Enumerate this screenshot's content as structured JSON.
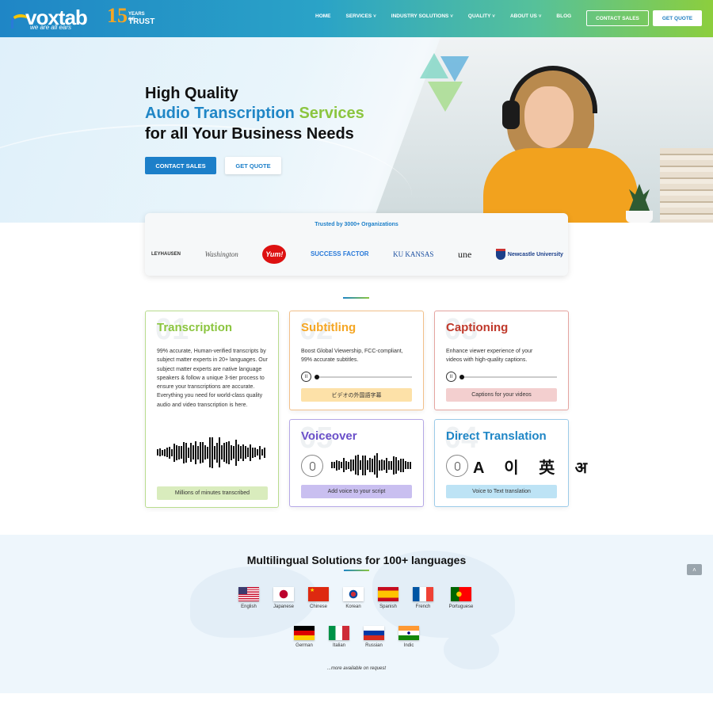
{
  "brand": {
    "name": "voxtab",
    "tagline": "we are all ears",
    "badge_number": "15",
    "badge_years": "YEARS OF",
    "badge_trust": "TRUST"
  },
  "nav": {
    "items": [
      {
        "label": "HOME",
        "dropdown": false
      },
      {
        "label": "SERVICES",
        "dropdown": true
      },
      {
        "label": "INDUSTRY SOLUTIONS",
        "dropdown": true
      },
      {
        "label": "QUALITY",
        "dropdown": true
      },
      {
        "label": "ABOUT US",
        "dropdown": true
      },
      {
        "label": "BLOG",
        "dropdown": false
      }
    ],
    "contact_sales": "CONTACT SALES",
    "get_quote": "GET QUOTE"
  },
  "hero": {
    "line1": "High Quality",
    "line2_a": "Audio Transcription",
    "line2_b": "Services",
    "line3": "for all Your Business Needs",
    "btn_contact": "CONTACT SALES",
    "btn_quote": "GET QUOTE"
  },
  "trusted": {
    "title": "Trusted by 3000+ Organizations",
    "orgs": [
      "LEYHAUSEN",
      "Washington",
      "Yum!",
      "SUCCESS FACTOR",
      "KU KANSAS",
      "une",
      "Newcastle University"
    ]
  },
  "cards": {
    "transcription": {
      "num": "01",
      "title": "Transcription",
      "text": "99% accurate, Human-verified transcripts by subject matter experts in 20+ languages. Our subject matter experts are native language speakers & follow a unique 3-tier process to ensure your transcriptions are accurate. Everything you need for world-class quality audio and video transcription is here.",
      "pill": "Millions of minutes transcribed"
    },
    "subtitling": {
      "num": "02",
      "title": "Subtitling",
      "text": "Boost Global Viewership, FCC-compliant, 99% accurate subtitles.",
      "pill": "ビデオの外国語字幕"
    },
    "captioning": {
      "num": "03",
      "title": "Captioning",
      "text": "Enhance viewer experience of your videos with high-quality captions.",
      "pill": "Captions for your videos"
    },
    "voiceover": {
      "num": "05",
      "title": "Voiceover",
      "pill": "Add voice to your script"
    },
    "translation": {
      "num": "04",
      "title": "Direct Translation",
      "glyphs": "A 이 英 अ",
      "pill": "Voice to Text translation"
    }
  },
  "multilingual": {
    "title": "Multilingual Solutions for 100+ languages",
    "languages": [
      "English",
      "Japanese",
      "Chinese",
      "Korean",
      "Spanish",
      "French",
      "Portuguese",
      "German",
      "Italian",
      "Russian",
      "Indic"
    ],
    "more": "...more available on request"
  },
  "colors": {
    "primary_blue": "#1c7fc9",
    "brand_green": "#8bc53f",
    "transcription": "#8bc53f",
    "subtitling": "#f5a623",
    "captioning": "#c0392b",
    "voiceover": "#6a4fc9",
    "translation": "#1f86c6"
  }
}
